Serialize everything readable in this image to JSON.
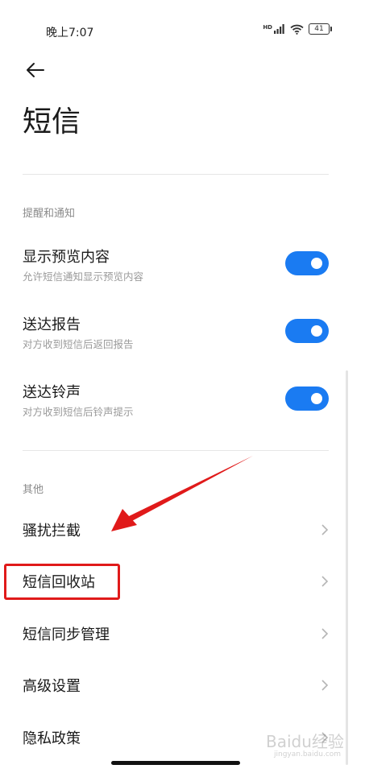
{
  "status_bar": {
    "time": "晚上7:07",
    "battery": "41",
    "signal_label": "HD"
  },
  "header": {
    "title": "短信"
  },
  "sections": {
    "notifications": {
      "header": "提醒和通知",
      "items": [
        {
          "title": "显示预览内容",
          "subtitle": "允许短信通知显示预览内容",
          "enabled": true
        },
        {
          "title": "送达报告",
          "subtitle": "对方收到短信后返回报告",
          "enabled": true
        },
        {
          "title": "送达铃声",
          "subtitle": "对方收到短信后铃声提示",
          "enabled": true
        }
      ]
    },
    "other": {
      "header": "其他",
      "items": [
        {
          "label": "骚扰拦截"
        },
        {
          "label": "短信回收站"
        },
        {
          "label": "短信同步管理"
        },
        {
          "label": "高级设置"
        },
        {
          "label": "隐私政策"
        }
      ]
    }
  },
  "watermark": {
    "text": "Baidu经验",
    "sub": "jingyan.baidu.com"
  },
  "colors": {
    "toggle_on": "#1a7bf2",
    "annotation_red": "#e01a1a"
  }
}
